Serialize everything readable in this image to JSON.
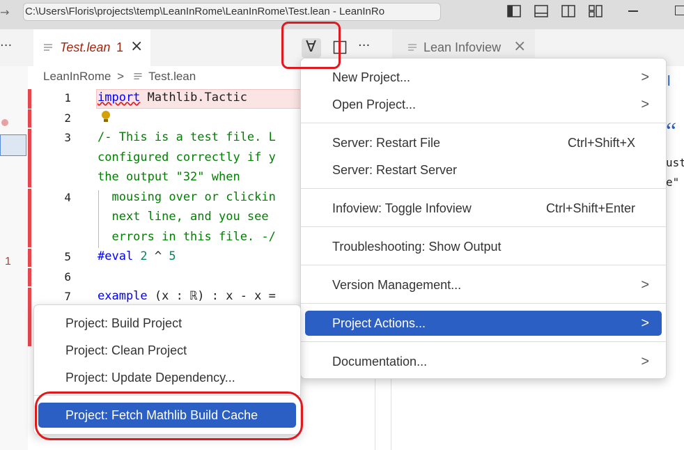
{
  "window": {
    "title": "C:\\Users\\Floris\\projects\\temp\\LeanInRome\\LeanInRome\\Test.lean - LeanInRo"
  },
  "tabs": {
    "more": "···",
    "editor_tab": {
      "label": "Test.lean",
      "problem_count": "1",
      "close": "×"
    },
    "infoview_tab": {
      "label": "Lean Infoview",
      "close": "×"
    },
    "actions_more": "···",
    "forall_symbol": "∀"
  },
  "breadcrumb": {
    "folder": "LeanInRome",
    "separator": ">",
    "file": "Test.lean"
  },
  "left_panel": {
    "problem_badge": "1"
  },
  "editor": {
    "line_numbers": [
      "1",
      "2",
      "3",
      "4",
      "5",
      "6",
      "7"
    ],
    "lines": {
      "l1_kw": "import",
      "l1_rest": " Mathlib.Tactic",
      "l3a": "/- This is a test file. L",
      "l3b": "configured correctly if y",
      "l3c": "the output \"32\" when",
      "l4a": "  mousing over or clickin",
      "l4b": "  next line, and you see",
      "l4c": "  errors in this file. -/",
      "l5_kw": "#eval",
      "l5_a": " 2",
      "l5_op": " ^ ",
      "l5_b": "5",
      "l7_kw": "example",
      "l7_rest": " (x : ℝ) : x - x ="
    }
  },
  "infoview_fragments": {
    "f1": "l",
    "f2": "“",
    "f3": "ust",
    "f4": "e\""
  },
  "menu": {
    "items": [
      {
        "label": "New Project...",
        "chevron": ">"
      },
      {
        "label": "Open Project...",
        "chevron": ">"
      },
      {
        "label": "Server: Restart File",
        "shortcut": "Ctrl+Shift+X"
      },
      {
        "label": "Server: Restart Server"
      },
      {
        "label": "Infoview: Toggle Infoview",
        "shortcut": "Ctrl+Shift+Enter"
      },
      {
        "label": "Troubleshooting: Show Output"
      },
      {
        "label": "Version Management...",
        "chevron": ">"
      },
      {
        "label": "Project Actions...",
        "chevron": ">"
      },
      {
        "label": "Documentation...",
        "chevron": ">"
      }
    ]
  },
  "submenu": {
    "items": [
      {
        "label": "Project: Build Project"
      },
      {
        "label": "Project: Clean Project"
      },
      {
        "label": "Project: Update Dependency..."
      },
      {
        "label": "Project: Fetch Mathlib Build Cache"
      }
    ]
  },
  "colors": {
    "highlight": "#2c5fc4",
    "annotation_red": "#e0191f",
    "error_gutter": "#e8464e"
  }
}
